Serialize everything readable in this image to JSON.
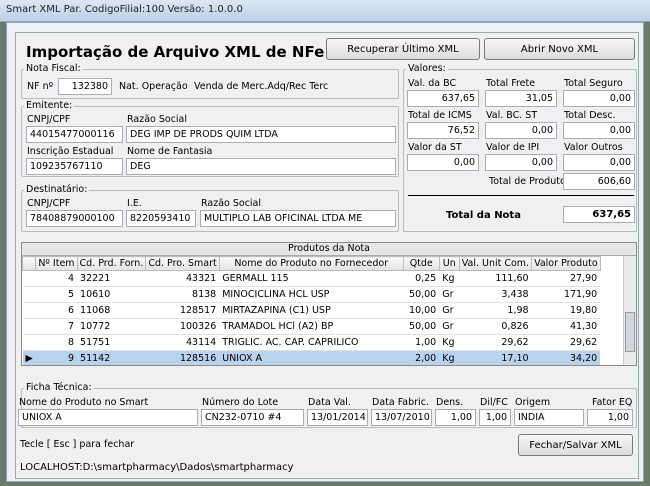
{
  "window_title": "Smart XML  Par. CodigoFilial:100  Versão: 1.0.0.0",
  "heading": "Importação de Arquivo XML de NFe",
  "buttons": {
    "recover": "Recuperar Último XML",
    "open_new": "Abrir Novo XML",
    "close_save": "Fechar/Salvar XML"
  },
  "nota_fiscal": {
    "group": "Nota Fiscal:",
    "nf_label": "NF nº",
    "nf_value": "132380",
    "nat_label": "Nat. Operação",
    "nat_value": "Venda de Merc.Adq/Rec Terc"
  },
  "emitente": {
    "group": "Emitente:",
    "cnpj_label": "CNPJ/CPF",
    "cnpj_value": "44015477000116",
    "razao_label": "Razão Social",
    "razao_value": "DEG IMP DE PRODS QUIM LTDA",
    "ie_label": "Inscrição Estadual",
    "ie_value": "109235767110",
    "fantasia_label": "Nome de Fantasia",
    "fantasia_value": "DEG"
  },
  "destinatario": {
    "group": "Destinatário:",
    "cnpj_label": "CNPJ/CPF",
    "cnpj_value": "78408879000100",
    "ie_label": "I.E.",
    "ie_value": "8220593410",
    "razao_label": "Razão Social",
    "razao_value": "MULTIPLO LAB OFICINAL LTDA ME"
  },
  "valores": {
    "group": "Valores:",
    "val_bc_label": "Val. da BC",
    "val_bc": "637,65",
    "frete_label": "Total Frete",
    "frete": "31,05",
    "seguro_label": "Total Seguro",
    "seguro": "0,00",
    "icms_label": "Total de ICMS",
    "icms": "76,52",
    "bc_st_label": "Val. BC. ST",
    "bc_st": "0,00",
    "desc_label": "Total Desc.",
    "desc": "0,00",
    "st_label": "Valor da ST",
    "st": "0,00",
    "ipi_label": "Valor de IPI",
    "ipi": "0,00",
    "outros_label": "Valor Outros",
    "outros": "0,00",
    "produtos_label": "Total de Produtos",
    "produtos": "606,60",
    "nota_label": "Total da Nota",
    "nota": "637,65"
  },
  "products": {
    "caption": "Produtos da Nota",
    "columns": [
      "Nº Item",
      "Cd. Prd. Forn.",
      "Cd. Pro. Smart",
      "Nome do Produto no Fornecedor",
      "Qtde",
      "Un",
      "Val. Unit Com.",
      "Valor Produto"
    ],
    "rows": [
      [
        "4",
        "32221",
        "43321",
        "GERMALL 115",
        "0,25",
        "Kg",
        "111,60",
        "27,90"
      ],
      [
        "5",
        "10610",
        "8138",
        "MINOCICLINA HCL USP",
        "50,00",
        "Gr",
        "3,438",
        "171,90"
      ],
      [
        "6",
        "11068",
        "128517",
        "MIRTAZAPINA (C1) USP",
        "10,00",
        "Gr",
        "1,98",
        "19,80"
      ],
      [
        "7",
        "10772",
        "100326",
        "TRAMADOL HCl (A2) BP",
        "50,00",
        "Gr",
        "0,826",
        "41,30"
      ],
      [
        "8",
        "51751",
        "43114",
        "TRIGLIC. AC. CAP. CAPRILICO",
        "1,00",
        "Kg",
        "29,62",
        "29,62"
      ],
      [
        "9",
        "51142",
        "128516",
        "UNIOX A",
        "2,00",
        "Kg",
        "17,10",
        "34,20"
      ]
    ]
  },
  "ficha": {
    "group": "Ficha Técnica:",
    "nome_label": "Nome do Produto no Smart",
    "nome_value": "UNIOX A",
    "lote_label": "Número do Lote",
    "lote_value": "CN232-0710  #4",
    "dataval_label": "Data Val.",
    "dataval_value": "13/01/2014",
    "datafab_label": "Data Fabric.",
    "datafab_value": "13/07/2010",
    "dens_label": "Dens.",
    "dens_value": "1,00",
    "dilfc_label": "Dil/FC",
    "dilfc_value": "1,00",
    "origem_label": "Origem",
    "origem_value": "INDIA",
    "fator_label": "Fator EQ",
    "fator_value": "1,00"
  },
  "hint": "Tecle [ Esc ] para fechar",
  "status_path": "LOCALHOST:D:\\smartpharmacy\\Dados\\smartpharmacy"
}
